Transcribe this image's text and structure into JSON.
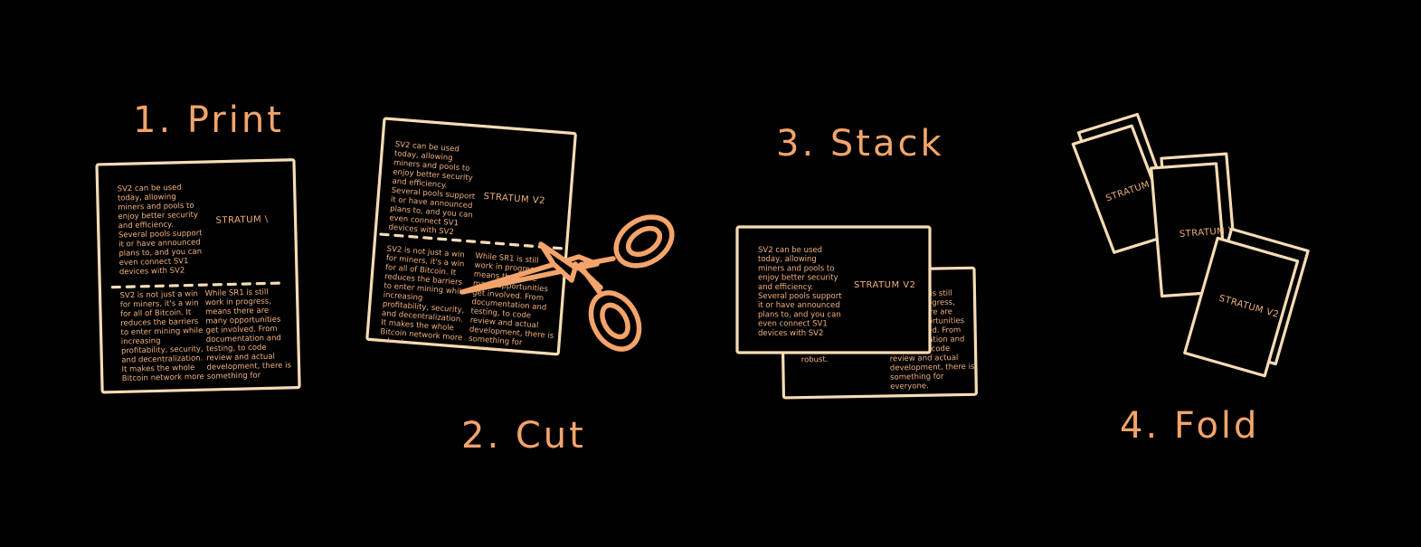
{
  "steps": {
    "print": {
      "title": "1. Print",
      "header": "STRATUM \\"
    },
    "cut": {
      "title": "2. Cut",
      "header": "STRATUM V2"
    },
    "stack": {
      "title": "3. Stack",
      "header": "STRATUM V2"
    },
    "fold": {
      "title": "4. Fold",
      "labels": [
        "STRATUM",
        "STRATUM V",
        "STRATUM V2"
      ]
    }
  },
  "text": {
    "top": [
      "SV2 can be used",
      "today, allowing",
      "miners and pools to",
      "enjoy better security",
      "and efficiency.",
      "Several pools support",
      "it or have announced",
      "plans to, and you can",
      "even connect SV1",
      "devices with SV2"
    ],
    "left": [
      "SV2 is not just a win",
      "for miners, it's a win",
      "for all of Bitcoin. It",
      "reduces the barriers",
      "to enter mining while",
      "increasing",
      "profitability, security,",
      "and decentralization.",
      "It makes the whole",
      "Bitcoin network more",
      "robust."
    ],
    "right": [
      "While SR1 is still",
      "work in progress,",
      "means there are",
      "many opportunities",
      "get involved. From",
      "documentation and",
      "testing, to code",
      "review and actual",
      "development, there is",
      "something for",
      "everyone."
    ]
  },
  "colors": {
    "accent": "#f4a46a",
    "paper_edge": "#f7dcb4",
    "dash": "#f7dcb4"
  }
}
